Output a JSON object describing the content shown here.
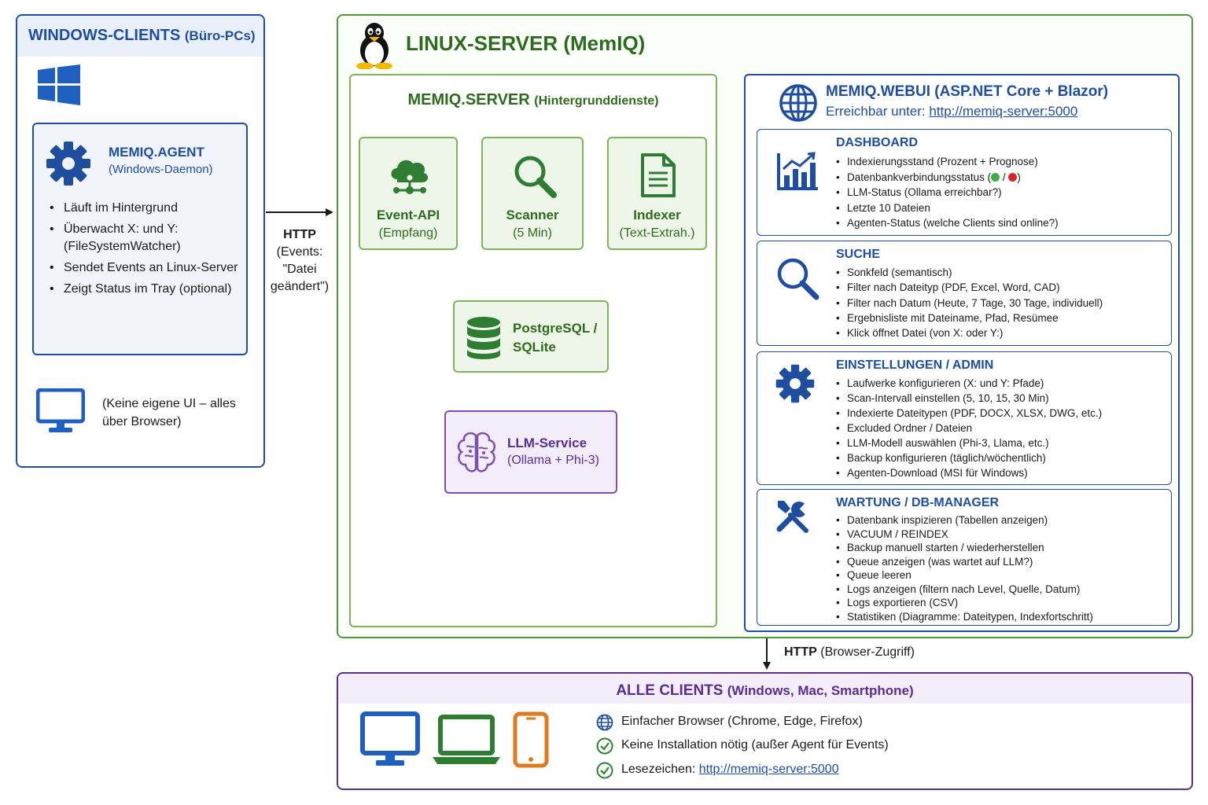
{
  "windows_clients": {
    "title": "WINDOWS-CLIENTS",
    "title_sub": "(Büro-PCs)",
    "agent": {
      "title": "MEMIQ.AGENT",
      "subtitle": "(Windows-Daemon)",
      "bullets": [
        "Läuft im Hintergrund",
        "Überwacht X: und Y: (FileSystemWatcher)",
        "Sendet Events an Linux-Server",
        "Zeigt Status im Tray (optional)"
      ]
    },
    "no_ui_note": "(Keine eigene UI – alles über Browser)"
  },
  "http_link": {
    "label": "HTTP",
    "detail": "(Events: \"Datei geändert\")"
  },
  "linux_server": {
    "title": "LINUX-SERVER (MemIQ)",
    "server": {
      "title": "MEMIQ.SERVER",
      "title_sub": "(Hintergrunddienste)",
      "services": [
        {
          "name": "Event-API",
          "detail": "(Empfang)"
        },
        {
          "name": "Scanner",
          "detail": "(5 Min)"
        },
        {
          "name": "Indexer",
          "detail": "(Text-Extrah.)"
        }
      ],
      "database": "PostgreSQL / SQLite",
      "llm": {
        "name": "LLM-Service",
        "detail": "(Ollama + Phi-3)"
      }
    },
    "webui": {
      "title": "MEMIQ.WEBUI (ASP.NET Core + Blazor)",
      "reach_label": "Erreichbar unter:",
      "reach_url": "http://memiq-server:5000",
      "cards": [
        {
          "title": "DASHBOARD",
          "items": [
            "Indexierungsstand (Prozent + Prognose)",
            "Datenbankverbindungsstatus (",
            "LLM-Status (Ollama erreichbar?)",
            "Letzte 10 Dateien",
            "Agenten-Status (welche Clients sind online?)"
          ],
          "status_sep": "/",
          "status_close": ")"
        },
        {
          "title": "SUCHE",
          "items": [
            "Sonkfeld (semantisch)",
            "Filter nach Dateityp (PDF, Excel, Word, CAD)",
            "Filter nach Datum (Heute, 7 Tage, 30 Tage, individuell)",
            "Ergebnisliste mit Dateiname, Pfad, Resümee",
            "Klick öffnet Datei (von X: oder Y:)"
          ]
        },
        {
          "title": "EINSTELLUNGEN / ADMIN",
          "items": [
            "Laufwerke konfigurieren (X: und Y: Pfade)",
            "Scan-Intervall einstellen (5, 10, 15, 30 Min)",
            "Indexierte Dateitypen (PDF, DOCX, XLSX, DWG, etc.)",
            "Excluded Ordner / Dateien",
            "LLM-Modell auswählen (Phi-3, Llama, etc.)",
            "Backup konfigurieren (täglich/wöchentlich)",
            "Agenten-Download (MSI für Windows)"
          ]
        },
        {
          "title": "WARTUNG / DB-MANAGER",
          "items": [
            "Datenbank inspizieren (Tabellen anzeigen)",
            "VACUUM / REINDEX",
            "Backup manuell starten / wiederherstellen",
            "Queue anzeigen (was wartet auf LLM?)",
            "Queue leeren",
            "Logs anzeigen (filtern nach Level, Quelle, Datum)",
            "Logs exportieren (CSV)",
            "Statistiken (Diagramme: Dateitypen, Indexfortschritt)"
          ]
        }
      ]
    }
  },
  "browser_link": {
    "label": "HTTP",
    "detail": "(Browser-Zugriff)"
  },
  "all_clients": {
    "title": "ALLE CLIENTS",
    "title_sub": "(Windows, Mac, Smartphone)",
    "features": [
      "Einfacher Browser (Chrome, Edge, Firefox)",
      "Keine Installation nötig (außer Agent für Events)",
      "Lesezeichen:"
    ],
    "bookmark_url": "http://memiq-server:5000"
  },
  "colors": {
    "windows_blue": "#1f4ea0",
    "linux_green": "#2e6b1e",
    "service_green": "#7fb35c",
    "llm_purple": "#5a2d91",
    "device_orange": "#e07a1f",
    "status_green": "#3cb043",
    "status_red": "#d9252b"
  },
  "icons": [
    "windows-logo-icon",
    "gear-icon",
    "monitor-icon",
    "tux-icon",
    "cloud-network-icon",
    "magnifier-icon",
    "document-icon",
    "database-icon",
    "brain-icon",
    "globe-icon",
    "bar-chart-icon",
    "wrench-screwdriver-icon",
    "laptop-icon",
    "phone-icon",
    "check-circle-icon"
  ]
}
